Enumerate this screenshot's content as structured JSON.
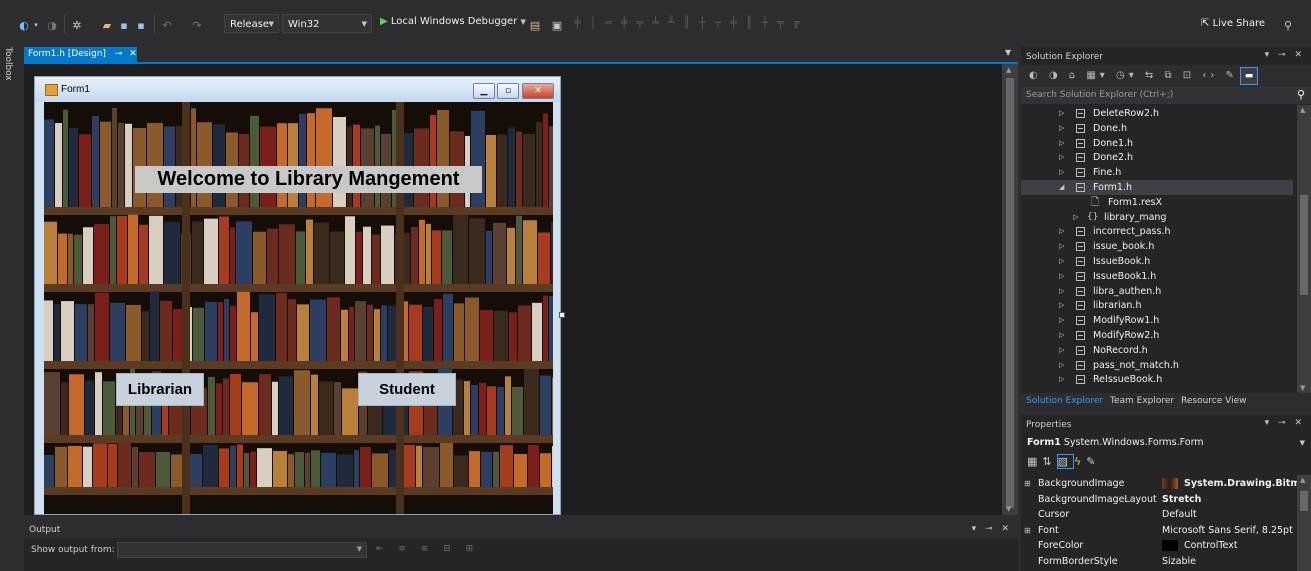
{
  "toolbar": {
    "configuration": "Release",
    "platform": "Win32",
    "debugger_label": "Local Windows Debugger",
    "live_share_label": "Live Share"
  },
  "toolbox": {
    "label": "Toolbox"
  },
  "document_tab": {
    "title": "Form1.h [Design]"
  },
  "form": {
    "title": "Form1",
    "welcome_label": "Welcome to Library Mangement",
    "librarian_button": "Librarian",
    "student_button": "Student"
  },
  "output": {
    "title": "Output",
    "show_from_label": "Show output from:"
  },
  "solution_explorer": {
    "title": "Solution Explorer",
    "search_placeholder": "Search Solution Explorer (Ctrl+;)",
    "items": [
      {
        "label": "DeleteRow2.h",
        "indent": 1,
        "type": "header",
        "expanded": false
      },
      {
        "label": "Done.h",
        "indent": 1,
        "type": "header",
        "expanded": false
      },
      {
        "label": "Done1.h",
        "indent": 1,
        "type": "header",
        "expanded": false
      },
      {
        "label": "Done2.h",
        "indent": 1,
        "type": "header",
        "expanded": false
      },
      {
        "label": "Fine.h",
        "indent": 1,
        "type": "header",
        "expanded": false
      },
      {
        "label": "Form1.h",
        "indent": 1,
        "type": "header",
        "expanded": true,
        "selected": true
      },
      {
        "label": "Form1.resX",
        "indent": 2,
        "type": "resource"
      },
      {
        "label": "library_mang",
        "indent": 2,
        "type": "namespace",
        "expanded": false
      },
      {
        "label": "incorrect_pass.h",
        "indent": 1,
        "type": "header",
        "expanded": false
      },
      {
        "label": "issue_book.h",
        "indent": 1,
        "type": "header",
        "expanded": false
      },
      {
        "label": "IssueBook.h",
        "indent": 1,
        "type": "header",
        "expanded": false
      },
      {
        "label": "IssueBook1.h",
        "indent": 1,
        "type": "header",
        "expanded": false
      },
      {
        "label": "libra_authen.h",
        "indent": 1,
        "type": "header",
        "expanded": false
      },
      {
        "label": "librarian.h",
        "indent": 1,
        "type": "header",
        "expanded": false
      },
      {
        "label": "ModifyRow1.h",
        "indent": 1,
        "type": "header",
        "expanded": false
      },
      {
        "label": "ModifyRow2.h",
        "indent": 1,
        "type": "header",
        "expanded": false
      },
      {
        "label": "NoRecord.h",
        "indent": 1,
        "type": "header",
        "expanded": false
      },
      {
        "label": "pass_not_match.h",
        "indent": 1,
        "type": "header",
        "expanded": false
      },
      {
        "label": "ReIssueBook.h",
        "indent": 1,
        "type": "header",
        "expanded": false
      }
    ],
    "tabs": [
      "Solution Explorer",
      "Team Explorer",
      "Resource View"
    ]
  },
  "properties": {
    "title": "Properties",
    "object_name": "Form1",
    "object_type": "System.Windows.Forms.Form",
    "rows": [
      {
        "name": "BackgroundImage",
        "value": "System.Drawing.Bitmap",
        "expandable": true,
        "bold": true,
        "swatch": "image"
      },
      {
        "name": "BackgroundImageLayout",
        "value": "Stretch",
        "bold": true
      },
      {
        "name": "Cursor",
        "value": "Default"
      },
      {
        "name": "Font",
        "value": "Microsoft Sans Serif, 8.25pt",
        "expandable": true
      },
      {
        "name": "ForeColor",
        "value": "ControlText",
        "swatch": "#000000"
      },
      {
        "name": "FormBorderStyle",
        "value": "Sizable"
      }
    ]
  },
  "colors": {
    "accent": "#007acc",
    "background": "#2d2d30",
    "editor": "#1e1e1e"
  }
}
